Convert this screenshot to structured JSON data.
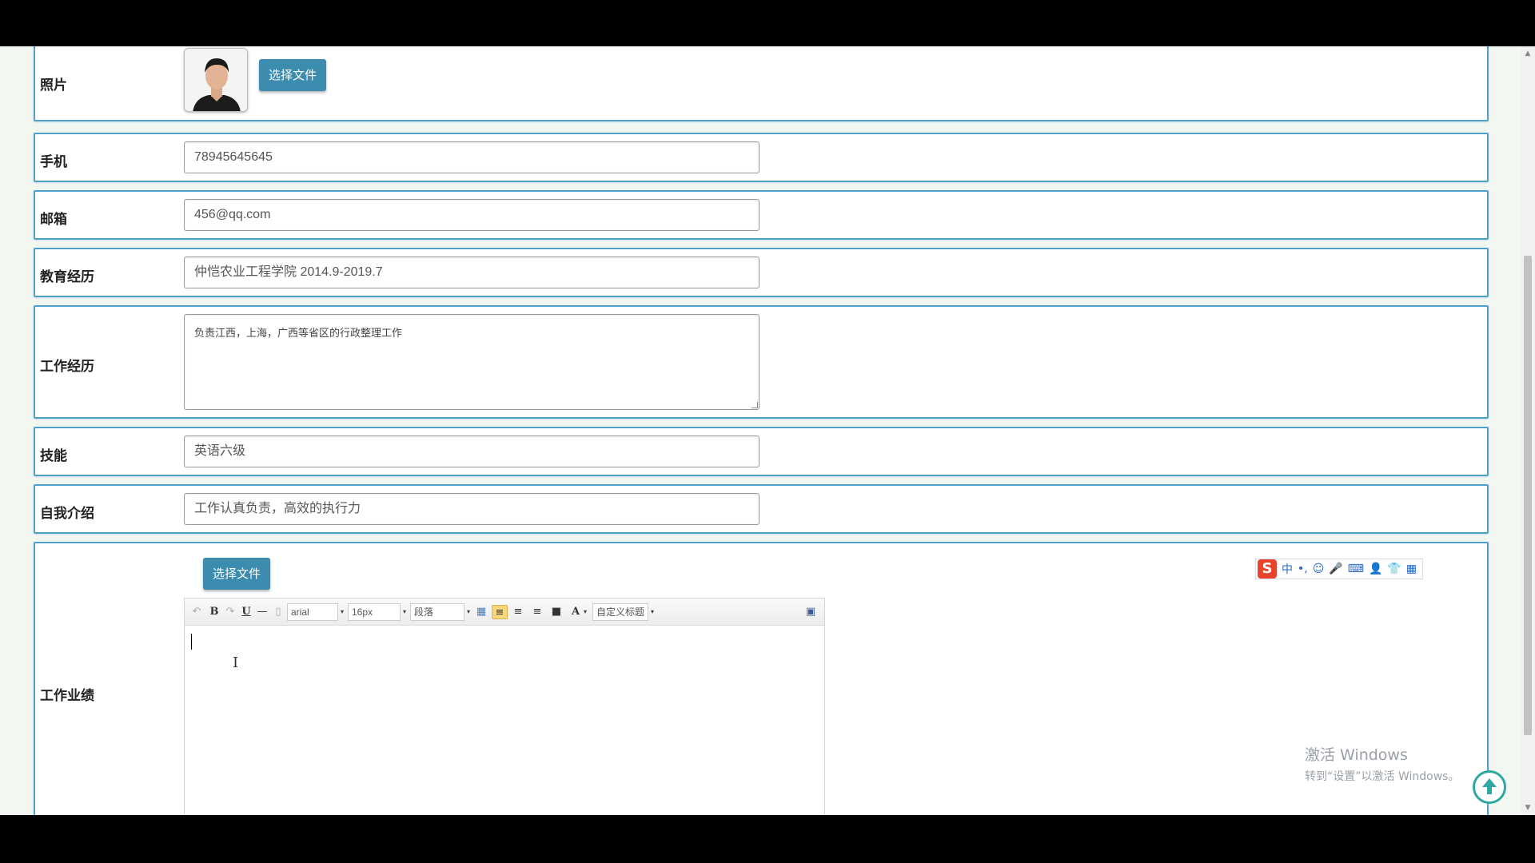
{
  "form": {
    "photo": {
      "label": "照片",
      "button": "选择文件"
    },
    "phone": {
      "label": "手机",
      "value": "78945645645"
    },
    "email": {
      "label": "邮箱",
      "value": "456@qq.com"
    },
    "education": {
      "label": "教育经历",
      "value": "仲恺农业工程学院 2014.9-2019.7"
    },
    "work": {
      "label": "工作经历",
      "value": "负责江西，上海，广西等省区的行政整理工作"
    },
    "skills": {
      "label": "技能",
      "value": "英语六级"
    },
    "intro": {
      "label": "自我介绍",
      "value": "工作认真负责，高效的执行力"
    },
    "achievements": {
      "label": "工作业绩",
      "button": "选择文件"
    }
  },
  "editor": {
    "font_family": "arial",
    "font_size": "16px",
    "paragraph": "段落",
    "custom_title": "自定义标题",
    "font_color_letter": "A",
    "bold": "B",
    "underline": "U"
  },
  "ime": {
    "logo": "S",
    "mode": "中",
    "punct": "•,",
    "icons": [
      "☺",
      "🎤",
      "⌨",
      "👤",
      "👕",
      "▦"
    ]
  },
  "watermark": {
    "line1": "激活 Windows",
    "line2": "转到“设置”以激活 Windows。"
  },
  "colors": {
    "border": "#4fa3c7",
    "button": "#3b8cae",
    "background": "#f3f7f2",
    "back_to_top": "#31a7a2"
  }
}
